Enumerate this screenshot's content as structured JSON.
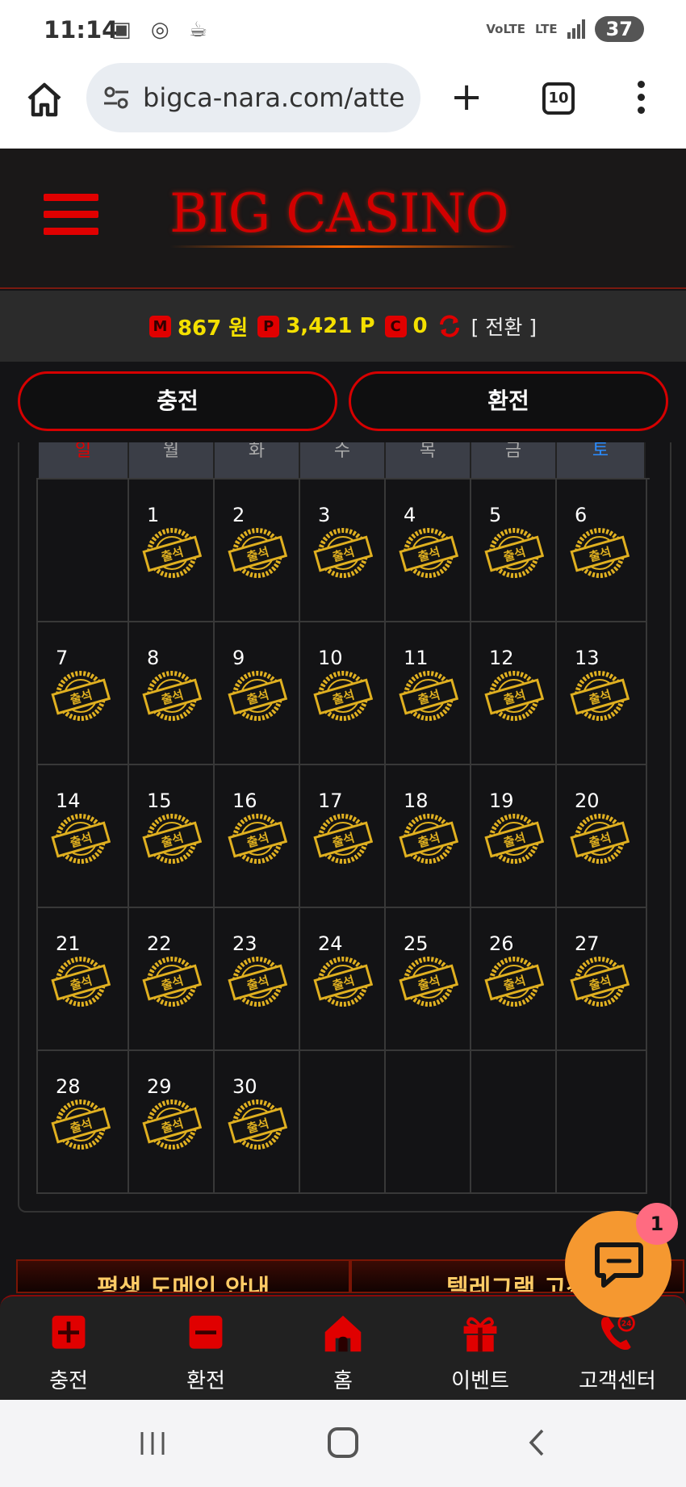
{
  "status_bar": {
    "time": "11:14",
    "network": "LTE",
    "volte": "VoLTE",
    "battery": "37"
  },
  "browser": {
    "url": "bigca-nara.com/atte",
    "tab_count": "10"
  },
  "header": {
    "logo": "BIG CASINO"
  },
  "balance": {
    "money_badge": "M",
    "money_value": "867 원",
    "point_badge": "P",
    "point_value": "3,421 P",
    "coin_badge": "C",
    "coin_value": "0",
    "convert_label": "[ 전환 ]"
  },
  "actions": {
    "charge": "충전",
    "exchange": "환전"
  },
  "calendar": {
    "weekdays": [
      "일",
      "월",
      "화",
      "수",
      "목",
      "금",
      "토"
    ],
    "stamp_label": "출석",
    "leading_blanks": 1,
    "days": [
      "1",
      "2",
      "3",
      "4",
      "5",
      "6",
      "7",
      "8",
      "9",
      "10",
      "11",
      "12",
      "13",
      "14",
      "15",
      "16",
      "17",
      "18",
      "19",
      "20",
      "21",
      "22",
      "23",
      "24",
      "25",
      "26",
      "27",
      "28",
      "29",
      "30"
    ]
  },
  "promos": {
    "left": "평생 도메인 안내",
    "right": "텔레그램 고객"
  },
  "chat": {
    "badge": "1"
  },
  "bottom_nav": {
    "items": [
      {
        "label": "충전",
        "icon": "plus-icon"
      },
      {
        "label": "환전",
        "icon": "minus-icon"
      },
      {
        "label": "홈",
        "icon": "home-icon"
      },
      {
        "label": "이벤트",
        "icon": "gift-icon"
      },
      {
        "label": "고객센터",
        "icon": "phone-24-icon"
      }
    ]
  },
  "colors": {
    "accent_red": "#e00000",
    "balance_yellow": "#f4e000",
    "stamp_gold": "#e0b020",
    "chat_orange": "#f59830"
  }
}
